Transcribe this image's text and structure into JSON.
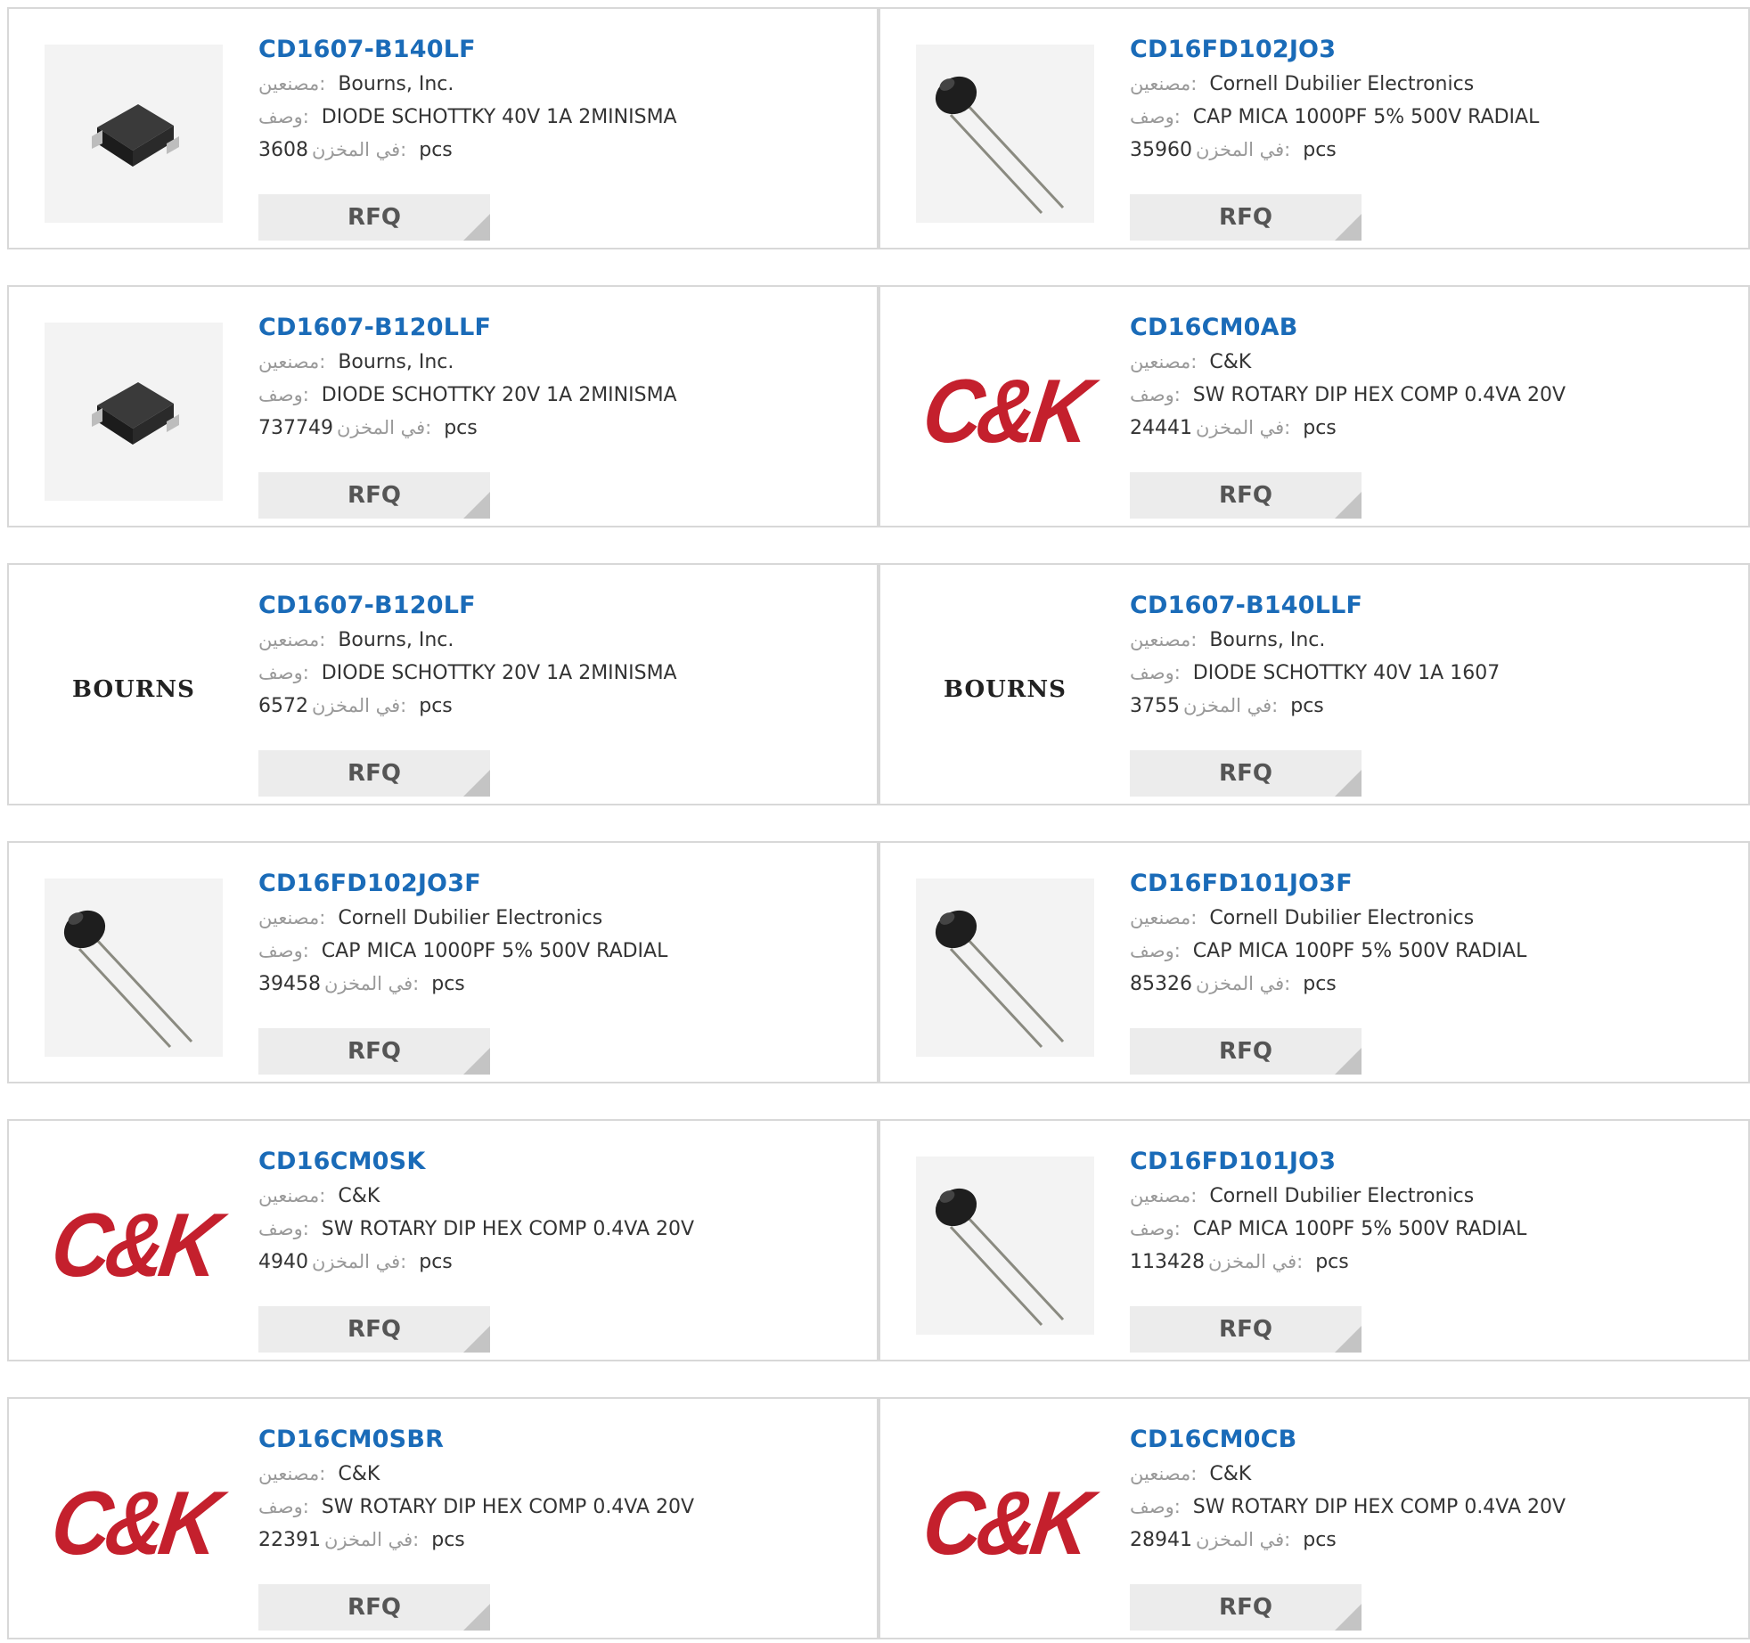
{
  "labels": {
    "manufacturer": "مصنعين:",
    "description": "وصف:",
    "stock": "في المخزن:",
    "unit": "pcs",
    "rfq": "RFQ"
  },
  "logos": {
    "ck": "C&K",
    "bourns": "BOURNS"
  },
  "colors": {
    "part_number": "#1a6bb8",
    "ck_logo": "#c4202d",
    "rfq_bg": "#ececec"
  },
  "products": [
    {
      "part": "CD1607-B140LF",
      "manufacturer": "Bourns, Inc.",
      "description": "DIODE SCHOTTKY 40V 1A 2MINISMA",
      "stock": "3608",
      "image": "diode-chip-image"
    },
    {
      "part": "CD16FD102JO3",
      "manufacturer": "Cornell Dubilier Electronics",
      "description": "CAP MICA 1000PF 5% 500V RADIAL",
      "stock": "35960",
      "image": "radial-capacitor-image"
    },
    {
      "part": "CD1607-B120LLF",
      "manufacturer": "Bourns, Inc.",
      "description": "DIODE SCHOTTKY 20V 1A 2MINISMA",
      "stock": "737749",
      "image": "diode-chip-image"
    },
    {
      "part": "CD16CM0AB",
      "manufacturer": "C&K",
      "description": "SW ROTARY DIP HEX COMP 0.4VA 20V",
      "stock": "24441",
      "image": "ck-logo"
    },
    {
      "part": "CD1607-B120LF",
      "manufacturer": "Bourns, Inc.",
      "description": "DIODE SCHOTTKY 20V 1A 2MINISMA",
      "stock": "6572",
      "image": "bourns-logo"
    },
    {
      "part": "CD1607-B140LLF",
      "manufacturer": "Bourns, Inc.",
      "description": "DIODE SCHOTTKY 40V 1A 1607",
      "stock": "3755",
      "image": "bourns-logo"
    },
    {
      "part": "CD16FD102JO3F",
      "manufacturer": "Cornell Dubilier Electronics",
      "description": "CAP MICA 1000PF 5% 500V RADIAL",
      "stock": "39458",
      "image": "radial-capacitor-image"
    },
    {
      "part": "CD16FD101JO3F",
      "manufacturer": "Cornell Dubilier Electronics",
      "description": "CAP MICA 100PF 5% 500V RADIAL",
      "stock": "85326",
      "image": "radial-capacitor-image"
    },
    {
      "part": "CD16CM0SK",
      "manufacturer": "C&K",
      "description": "SW ROTARY DIP HEX COMP 0.4VA 20V",
      "stock": "4940",
      "image": "ck-logo"
    },
    {
      "part": "CD16FD101JO3",
      "manufacturer": "Cornell Dubilier Electronics",
      "description": "CAP MICA 100PF 5% 500V RADIAL",
      "stock": "113428",
      "image": "radial-capacitor-image"
    },
    {
      "part": "CD16CM0SBR",
      "manufacturer": "C&K",
      "description": "SW ROTARY DIP HEX COMP 0.4VA 20V",
      "stock": "22391",
      "image": "ck-logo"
    },
    {
      "part": "CD16CM0CB",
      "manufacturer": "C&K",
      "description": "SW ROTARY DIP HEX COMP 0.4VA 20V",
      "stock": "28941",
      "image": "ck-logo"
    }
  ]
}
